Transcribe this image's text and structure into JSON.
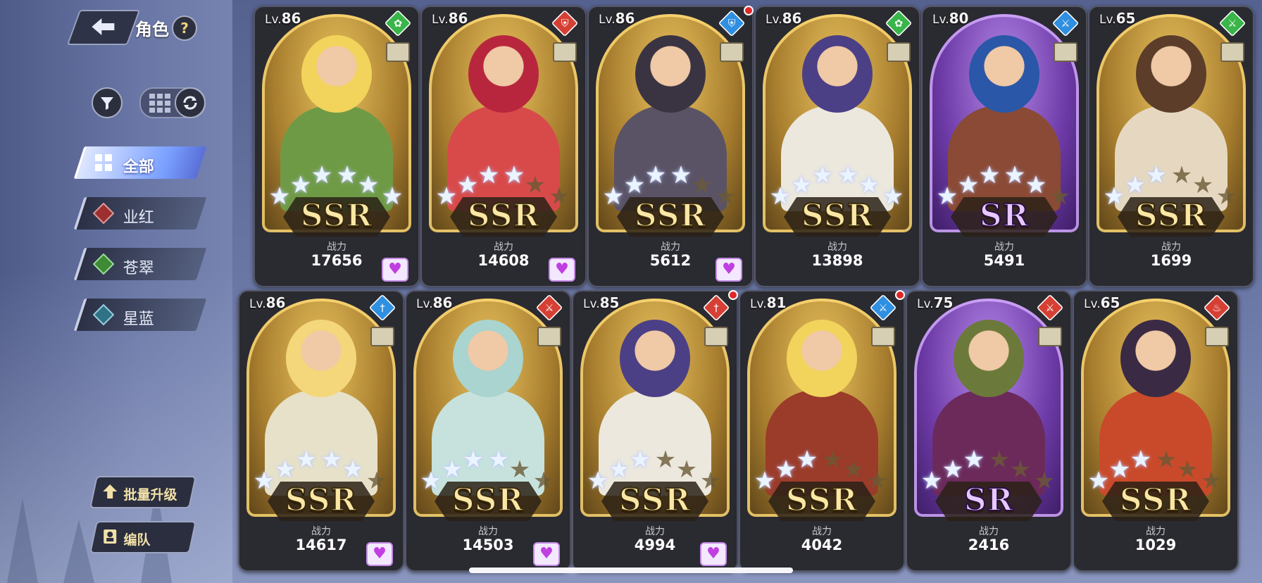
{
  "header": {
    "title": "角色",
    "help_label": "?"
  },
  "filters": [
    {
      "label": "全部",
      "active": true,
      "color": "#7aa0ff"
    },
    {
      "label": "业红",
      "active": false,
      "color": "#b43c3c"
    },
    {
      "label": "苍翠",
      "active": false,
      "color": "#3f9a3c"
    },
    {
      "label": "星蓝",
      "active": false,
      "color": "#2f8a9a"
    }
  ],
  "actions": {
    "batch_upgrade": "批量升级",
    "formation": "编队"
  },
  "power_label": "战力",
  "level_prefix": "Lv.",
  "cards": [
    {
      "level": "86",
      "rarity": "SSR",
      "power": "17656",
      "element": "green",
      "element_icon": "leaf-icon",
      "favorite": true,
      "stars": 6,
      "new": false,
      "theme": "gold",
      "skin": "#f2d35c",
      "outfit": "#6f9a45"
    },
    {
      "level": "86",
      "rarity": "SSR",
      "power": "14608",
      "element": "red",
      "element_icon": "shield-icon",
      "favorite": true,
      "stars": 4,
      "new": false,
      "theme": "gold",
      "skin": "#b8263d",
      "outfit": "#d84a4a"
    },
    {
      "level": "86",
      "rarity": "SSR",
      "power": "5612",
      "element": "blue",
      "element_icon": "shield-icon",
      "favorite": true,
      "stars": 4,
      "new": true,
      "theme": "gold",
      "skin": "#3a3442",
      "outfit": "#5a5366"
    },
    {
      "level": "86",
      "rarity": "SSR",
      "power": "13898",
      "element": "green",
      "element_icon": "leaf-icon",
      "favorite": false,
      "stars": 6,
      "new": false,
      "theme": "gold",
      "skin": "#4b3f86",
      "outfit": "#ece8de"
    },
    {
      "level": "80",
      "rarity": "SR",
      "power": "5491",
      "element": "blue",
      "element_icon": "sword-icon",
      "favorite": false,
      "stars": 5,
      "new": false,
      "theme": "purple",
      "skin": "#2a57a8",
      "outfit": "#8a4a36"
    },
    {
      "level": "65",
      "rarity": "SSR",
      "power": "1699",
      "element": "green",
      "element_icon": "sword-icon",
      "favorite": false,
      "stars": 3,
      "new": false,
      "theme": "gold",
      "skin": "#5b3d2a",
      "outfit": "#e6d8c0"
    },
    {
      "level": "86",
      "rarity": "SSR",
      "power": "14617",
      "element": "blue",
      "element_icon": "dagger-icon",
      "favorite": true,
      "stars": 5,
      "new": false,
      "theme": "gold",
      "skin": "#f4d77a",
      "outfit": "#e7e1c9"
    },
    {
      "level": "86",
      "rarity": "SSR",
      "power": "14503",
      "element": "red",
      "element_icon": "sword-icon",
      "favorite": true,
      "stars": 4,
      "new": false,
      "theme": "gold",
      "skin": "#a9d4cf",
      "outfit": "#c7e2dd"
    },
    {
      "level": "85",
      "rarity": "SSR",
      "power": "4994",
      "element": "red",
      "element_icon": "dagger-icon",
      "favorite": true,
      "stars": 3,
      "new": true,
      "theme": "gold",
      "skin": "#4b3f86",
      "outfit": "#ece8de"
    },
    {
      "level": "81",
      "rarity": "SSR",
      "power": "4042",
      "element": "blue",
      "element_icon": "sword-icon",
      "favorite": false,
      "stars": 3,
      "new": true,
      "theme": "gold",
      "skin": "#f2d35c",
      "outfit": "#9b3b2a"
    },
    {
      "level": "75",
      "rarity": "SR",
      "power": "2416",
      "element": "red",
      "element_icon": "sword-icon",
      "favorite": false,
      "stars": 3,
      "new": false,
      "theme": "purple",
      "skin": "#6b7a3a",
      "outfit": "#6b2a5a"
    },
    {
      "level": "65",
      "rarity": "SSR",
      "power": "1029",
      "element": "red",
      "element_icon": "flame-icon",
      "favorite": false,
      "stars": 3,
      "new": false,
      "theme": "gold",
      "skin": "#3a2a44",
      "outfit": "#c94a2a"
    }
  ],
  "element_colors": {
    "green": "#39b54a",
    "red": "#d64034",
    "blue": "#2f8fe0"
  }
}
